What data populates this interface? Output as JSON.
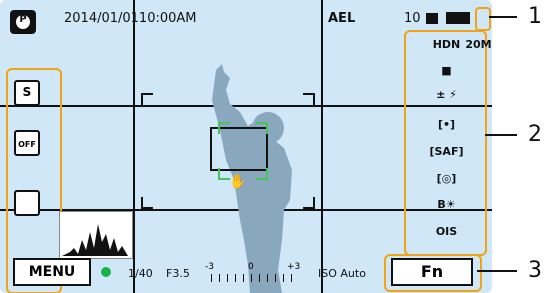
{
  "top_bar": {
    "datetime": "2014/01/0110:00AM",
    "ael_label": "AEL",
    "shots_remaining": "10"
  },
  "left_controls": {
    "items": [
      {
        "name": "smart-shutter-icon",
        "label": "S"
      },
      {
        "name": "off-mode-icon",
        "label": "OFF"
      },
      {
        "name": "touch-af-icon",
        "label": ""
      }
    ]
  },
  "bottom_bar": {
    "menu_label": "MENU",
    "shutter_speed": "1/40",
    "aperture": "F3.5",
    "ev_min": "-3",
    "ev_zero": "0",
    "ev_max": "+3",
    "iso_label": "ISO Auto",
    "fn_label": "Fn"
  },
  "right_panel": {
    "items": [
      {
        "name": "quality-icon",
        "label": "HDN"
      },
      {
        "name": "resolution-icon",
        "label": "20M"
      },
      {
        "name": "ratio-icon",
        "label": "■"
      },
      {
        "name": "flash-ev-icon",
        "label": "± ⚡"
      },
      {
        "name": "metering-icon",
        "label": "[•]"
      },
      {
        "name": "saf-icon",
        "label": "[SAF]"
      },
      {
        "name": "af-area-icon",
        "label": "[◎]"
      },
      {
        "name": "wb-icon",
        "label": "B☀"
      },
      {
        "name": "ois-icon",
        "label": "OIS"
      }
    ]
  },
  "callouts": [
    "1",
    "2",
    "3"
  ],
  "colors": {
    "screen_bg": "#cfe7f6",
    "highlight": "#f2a314",
    "focus_green": "#18b24a"
  }
}
